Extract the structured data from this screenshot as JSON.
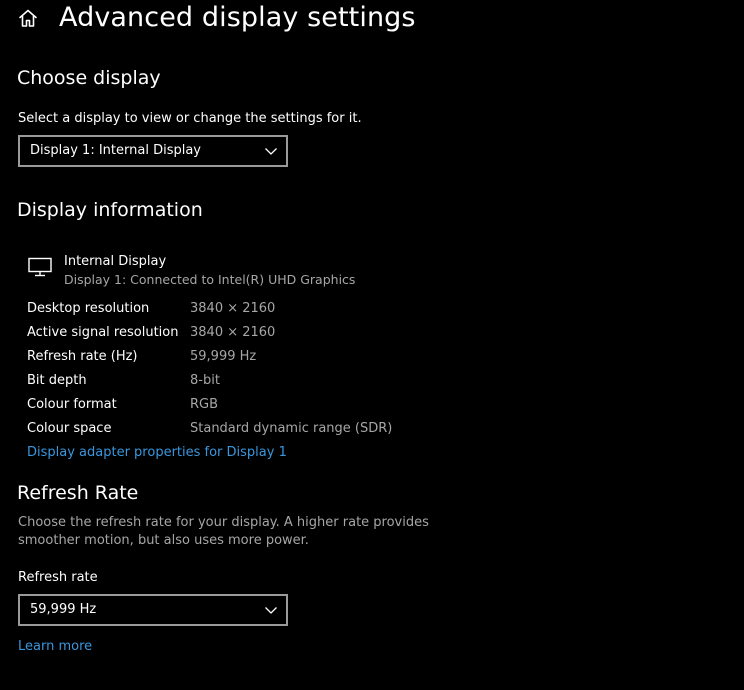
{
  "header": {
    "title": "Advanced display settings",
    "home_icon": "home-icon"
  },
  "choose_display": {
    "title": "Choose display",
    "description": "Select a display to view or change the settings for it.",
    "selected_display": "Display 1: Internal Display"
  },
  "display_information": {
    "title": "Display information",
    "monitor_icon": "monitor-icon",
    "display_name": "Internal Display",
    "display_subtitle": "Display 1: Connected to Intel(R) UHD Graphics",
    "rows": [
      {
        "label": "Desktop resolution",
        "value": "3840 × 2160"
      },
      {
        "label": "Active signal resolution",
        "value": "3840 × 2160"
      },
      {
        "label": "Refresh rate (Hz)",
        "value": "59,999 Hz"
      },
      {
        "label": "Bit depth",
        "value": "8-bit"
      },
      {
        "label": "Colour format",
        "value": "RGB"
      },
      {
        "label": "Colour space",
        "value": "Standard dynamic range (SDR)"
      }
    ],
    "adapter_link": "Display adapter properties for Display 1"
  },
  "refresh_rate": {
    "title": "Refresh Rate",
    "description_line1": "Choose the refresh rate for your display. A higher rate provides",
    "description_line2": "smoother motion, but also uses more power.",
    "field_label": "Refresh rate",
    "selected_rate": "59,999 Hz",
    "learn_more": "Learn more"
  },
  "colors": {
    "background": "#000000",
    "text_primary": "#ffffff",
    "text_secondary": "#a6a6a6",
    "link": "#3a96dd",
    "dropdown_border": "#9a9a9a"
  }
}
